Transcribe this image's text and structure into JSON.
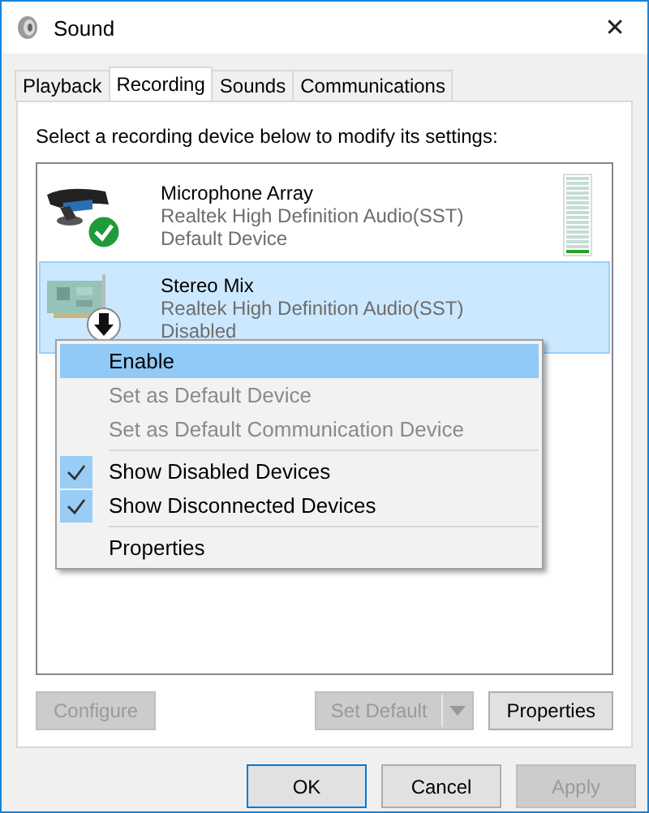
{
  "window": {
    "title": "Sound",
    "close": "✕"
  },
  "tabs": [
    {
      "label": "Playback",
      "selected": false
    },
    {
      "label": "Recording",
      "selected": true
    },
    {
      "label": "Sounds",
      "selected": false
    },
    {
      "label": "Communications",
      "selected": false
    }
  ],
  "instruction": "Select a recording device below to modify its settings:",
  "devices": [
    {
      "kind": "microphone",
      "name": "Microphone Array",
      "driver": "Realtek High Definition Audio(SST)",
      "status": "Default Device",
      "default": true,
      "disabled": false,
      "selected": false,
      "level": 0.08
    },
    {
      "kind": "board",
      "name": "Stereo Mix",
      "driver": "Realtek High Definition Audio(SST)",
      "status": "Disabled",
      "default": false,
      "disabled": true,
      "selected": true
    }
  ],
  "context_menu": {
    "groups": [
      [
        {
          "label": "Enable",
          "disabled": false,
          "checked": false,
          "selected": true
        },
        {
          "label": "Set as Default Device",
          "disabled": true,
          "checked": false,
          "selected": false
        },
        {
          "label": "Set as Default Communication Device",
          "disabled": true,
          "checked": false,
          "selected": false
        }
      ],
      [
        {
          "label": "Show Disabled Devices",
          "disabled": false,
          "checked": true,
          "selected": false
        },
        {
          "label": "Show Disconnected Devices",
          "disabled": false,
          "checked": true,
          "selected": false
        }
      ],
      [
        {
          "label": "Properties",
          "disabled": false,
          "checked": false,
          "selected": false
        }
      ]
    ]
  },
  "panel_buttons": {
    "configure": {
      "label": "Configure",
      "disabled": true
    },
    "set_default": {
      "label": "Set Default",
      "disabled": true
    },
    "properties": {
      "label": "Properties",
      "disabled": false
    }
  },
  "dialog_buttons": [
    {
      "label": "OK",
      "disabled": false,
      "default": true
    },
    {
      "label": "Cancel",
      "disabled": false,
      "default": false
    },
    {
      "label": "Apply",
      "disabled": true,
      "default": false
    }
  ]
}
